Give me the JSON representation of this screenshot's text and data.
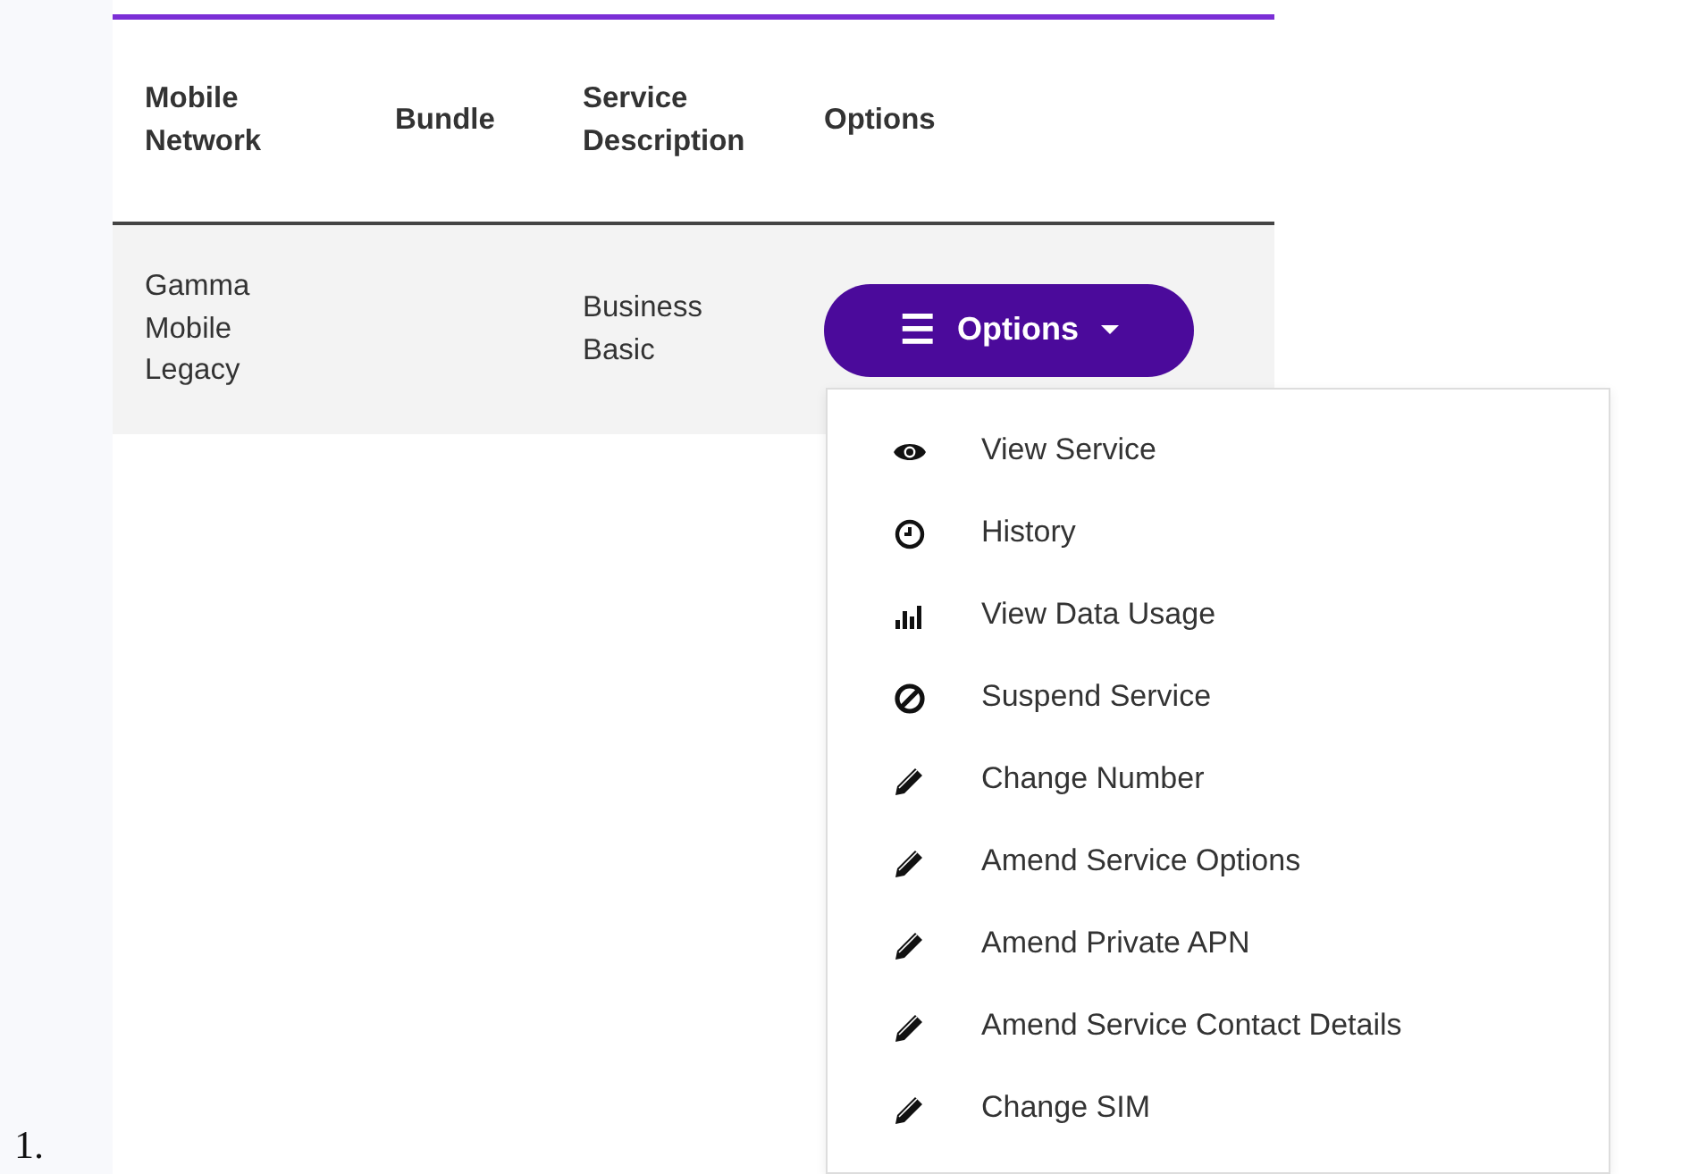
{
  "list_marker": "1.",
  "table": {
    "columns": [
      "Mobile Network",
      "Bundle",
      "Service Description",
      "Options"
    ],
    "rows": [
      {
        "mobile_network": "Gamma Mobile Legacy",
        "bundle": "",
        "service_description": "Business Basic",
        "options_button": {
          "icon": "☰",
          "label": "Options",
          "expanded": true
        }
      }
    ]
  },
  "dropdown_menu": [
    {
      "kind": "view",
      "label": "View Service"
    },
    {
      "kind": "history",
      "label": "History"
    },
    {
      "kind": "usage",
      "label": "View Data Usage"
    },
    {
      "kind": "suspend",
      "label": "Suspend Service"
    },
    {
      "kind": "edit",
      "label": "Change Number"
    },
    {
      "kind": "edit",
      "label": "Amend Service Options"
    },
    {
      "kind": "edit",
      "label": "Amend Private APN"
    },
    {
      "kind": "edit",
      "label": "Amend Service Contact Details"
    },
    {
      "kind": "edit",
      "label": "Change SIM"
    }
  ]
}
